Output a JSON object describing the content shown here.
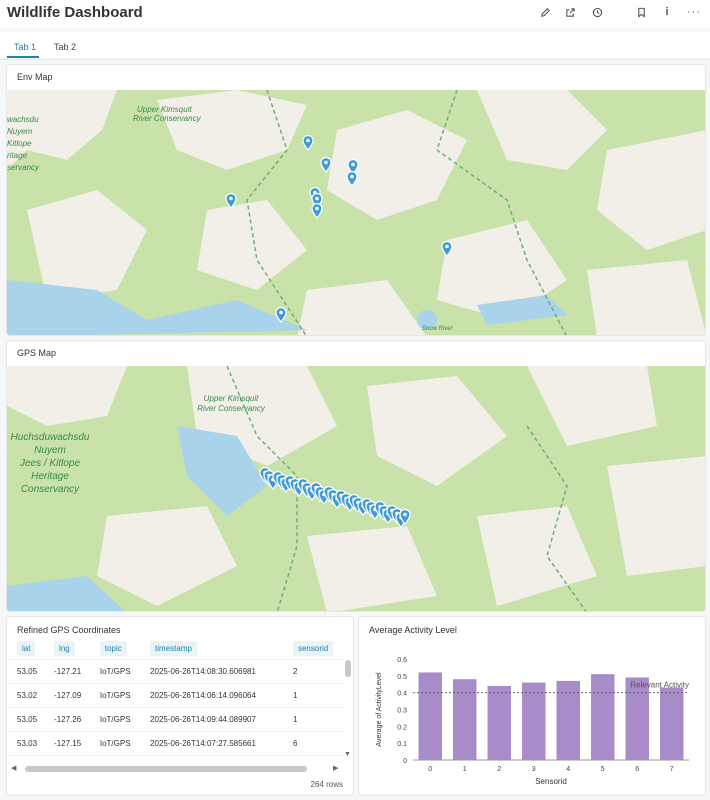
{
  "header": {
    "title": "Wildlife Dashboard",
    "icons": [
      "edit-icon",
      "share-icon",
      "history-icon",
      "bookmark-icon",
      "info-icon",
      "more-icon"
    ]
  },
  "tabs": [
    {
      "label": "Tab 1",
      "active": true
    },
    {
      "label": "Tab 2",
      "active": false
    }
  ],
  "env_map": {
    "title": "Env Map",
    "labels": {
      "upper_kimsquit_1": "Upper Kimsquit",
      "upper_kimsquit_2": "River Conservancy",
      "left_cut": [
        "wachsdu",
        "Nuyem",
        "Kitlope",
        "ritage",
        "servancy"
      ],
      "bottom_label": "Snow River"
    },
    "pin_color": "#3f9ad6"
  },
  "gps_map": {
    "title": "GPS Map",
    "labels": {
      "upper_kimsquit_1": "Upper Kimsquit",
      "upper_kimsquit_2": "River Conservancy",
      "huchsdu": [
        "Huchsduwachsdu",
        "Nuyem",
        "Jees / Kitlope",
        "Heritage",
        "Conservancy"
      ]
    },
    "pin_color": "#3f9ad6"
  },
  "table": {
    "title": "Refined GPS Coordinates",
    "columns": [
      "lat",
      "lng",
      "topic",
      "timestamp",
      "sensorid"
    ],
    "rows": [
      [
        "53.05",
        "-127.21",
        "IoT/GPS",
        "2025-06-26T14:08:30.606981",
        "2"
      ],
      [
        "53.02",
        "-127.09",
        "IoT/GPS",
        "2025-06-26T14:06:14.096064",
        "1"
      ],
      [
        "53.05",
        "-127.26",
        "IoT/GPS",
        "2025-06-26T14:09:44.089907",
        "1"
      ],
      [
        "53.03",
        "-127.15",
        "IoT/GPS",
        "2025-06-26T14:07:27.585661",
        "6"
      ]
    ],
    "row_count": "264 rows"
  },
  "chart": {
    "title": "Average Activity Level"
  },
  "chart_data": {
    "type": "bar",
    "title": "Average Activity Level",
    "xlabel": "Sensorid",
    "ylabel": "Average of ActivityLevel",
    "categories": [
      "0",
      "1",
      "2",
      "3",
      "4",
      "5",
      "6",
      "7"
    ],
    "values": [
      0.52,
      0.48,
      0.44,
      0.46,
      0.47,
      0.51,
      0.49,
      0.43
    ],
    "ylim": [
      0,
      0.6
    ],
    "yticks": [
      "0",
      "0.1",
      "0.2",
      "0.3",
      "0.4",
      "0.5",
      "0.6"
    ],
    "reference_line": {
      "label": "Relevant Activity",
      "value": 0.4
    },
    "bar_color": "#a88bc9",
    "grid": false
  }
}
